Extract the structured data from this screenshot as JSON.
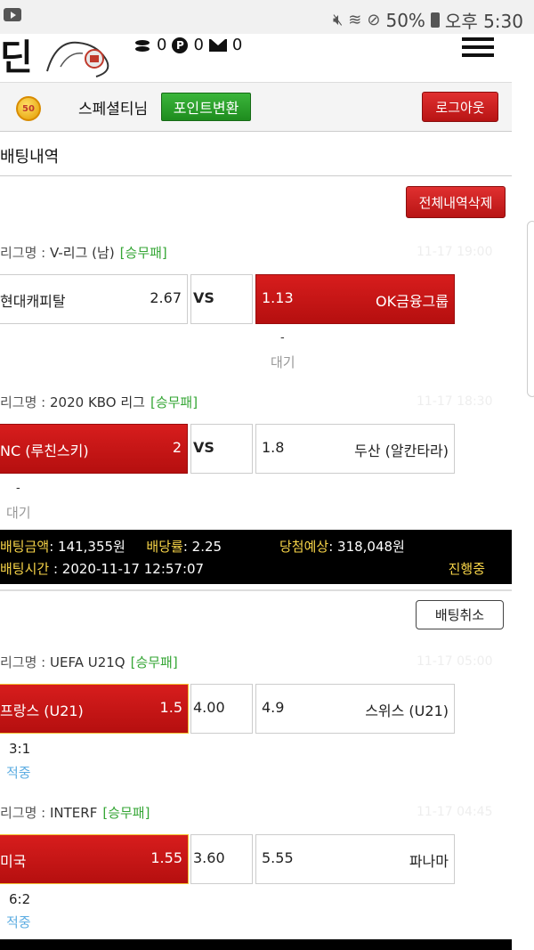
{
  "status_bar": {
    "battery": "50%",
    "time": "오후 5:30"
  },
  "header": {
    "logo": "딘",
    "coins": "0",
    "points": "0",
    "messages": "0",
    "point_icon_letter": "P"
  },
  "user": {
    "level": "50",
    "name": "스페셜티님",
    "point_convert_label": "포인트변환",
    "logout_label": "로그아웃"
  },
  "section_title": "배팅내역",
  "delete_all_label": "전체내역삭제",
  "league_prefix": "리그명 : ",
  "group1": {
    "bets": [
      {
        "league": "V-리그 (남)",
        "type": "[승무패]",
        "time": "11-17 19:00",
        "home": "현대캐피탈",
        "home_odds": "2.67",
        "mid": "VS",
        "away_odds": "1.13",
        "away": "OK금융그룹",
        "result_dash": "-",
        "result": "대기"
      },
      {
        "league": "2020 KBO 리그",
        "type": "[승무패]",
        "time": "11-17 18:30",
        "home": "NC (루친스키)",
        "home_odds": "2",
        "mid": "VS",
        "away_odds": "1.8",
        "away": "두산 (알칸타라)",
        "result_dash": "-",
        "result": "대기"
      }
    ],
    "summary": {
      "amount_label": "배팅금액",
      "amount": ": 141,355원",
      "rate_label": "배당률",
      "rate": ": 2.25",
      "expect_label": "당첨예상",
      "expect": ": 318,048원",
      "time_label": "배팅시간",
      "time": " : 2020-11-17 12:57:07",
      "status": "진행중"
    }
  },
  "cancel_label": "배팅취소",
  "group2": {
    "bets": [
      {
        "league": "UEFA U21Q",
        "type": "[승무패]",
        "time": "11-17 05:00",
        "home": "프랑스 (U21)",
        "home_odds": "1.5",
        "mid": "4.00",
        "away_odds": "4.9",
        "away": "스위스 (U21)",
        "score": "3:1",
        "result": "적중"
      },
      {
        "league": "INTERF",
        "type": "[승무패]",
        "time": "11-17 04:45",
        "home": "미국",
        "home_odds": "1.55",
        "mid": "3.60",
        "away_odds": "5.55",
        "away": "파나마",
        "score": "6:2",
        "result": "적중"
      }
    ]
  },
  "colors": {
    "accent_red": "#c41414",
    "green": "#2aa02a",
    "gold": "#f7d448",
    "win_blue": "#5dade2"
  }
}
